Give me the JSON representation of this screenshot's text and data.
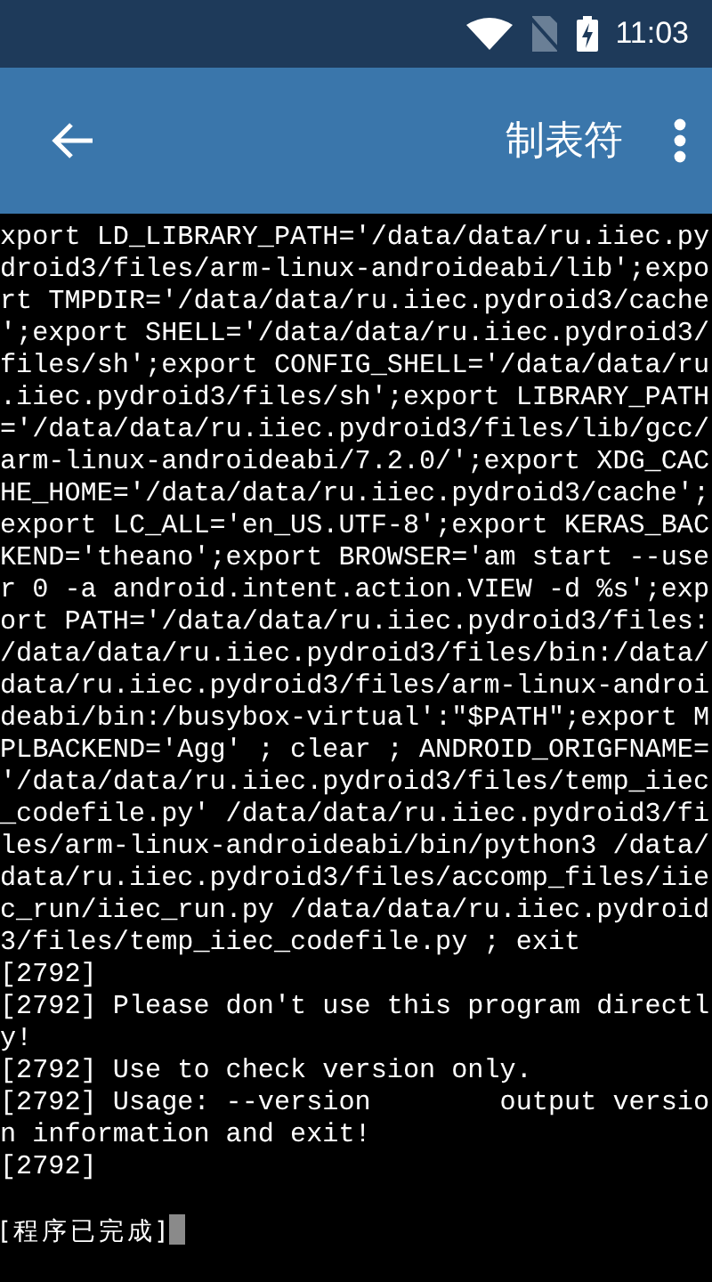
{
  "status_bar": {
    "time": "11:03"
  },
  "app_bar": {
    "title": "制表符"
  },
  "terminal": {
    "lines": [
      "xport LD_LIBRARY_PATH='/data/data/ru.iiec.py",
      "droid3/files/arm-linux-androideabi/lib';expo",
      "rt TMPDIR='/data/data/ru.iiec.pydroid3/cache",
      "';export SHELL='/data/data/ru.iiec.pydroid3/",
      "files/sh';export CONFIG_SHELL='/data/data/ru",
      ".iiec.pydroid3/files/sh';export LIBRARY_PATH",
      "='/data/data/ru.iiec.pydroid3/files/lib/gcc/",
      "arm-linux-androideabi/7.2.0/';export XDG_CAC",
      "HE_HOME='/data/data/ru.iiec.pydroid3/cache';",
      "export LC_ALL='en_US.UTF-8';export KERAS_BAC",
      "KEND='theano';export BROWSER='am start --use",
      "r 0 -a android.intent.action.VIEW -d %s';exp",
      "ort PATH='/data/data/ru.iiec.pydroid3/files:",
      "/data/data/ru.iiec.pydroid3/files/bin:/data/",
      "data/ru.iiec.pydroid3/files/arm-linux-androi",
      "deabi/bin:/busybox-virtual':\"$PATH\";export M",
      "PLBACKEND='Agg' ; clear ; ANDROID_ORIGFNAME=",
      "'/data/data/ru.iiec.pydroid3/files/temp_iiec",
      "_codefile.py' /data/data/ru.iiec.pydroid3/fi",
      "les/arm-linux-androideabi/bin/python3 /data/",
      "data/ru.iiec.pydroid3/files/accomp_files/iie",
      "c_run/iiec_run.py /data/data/ru.iiec.pydroid",
      "3/files/temp_iiec_codefile.py ; exit",
      "[2792]",
      "[2792] Please don't use this program directl",
      "y!",
      "[2792] Use to check version only.",
      "[2792] Usage: --version        output versio",
      "n information and exit!",
      "[2792]"
    ],
    "finished_message": "[程序已完成]"
  }
}
